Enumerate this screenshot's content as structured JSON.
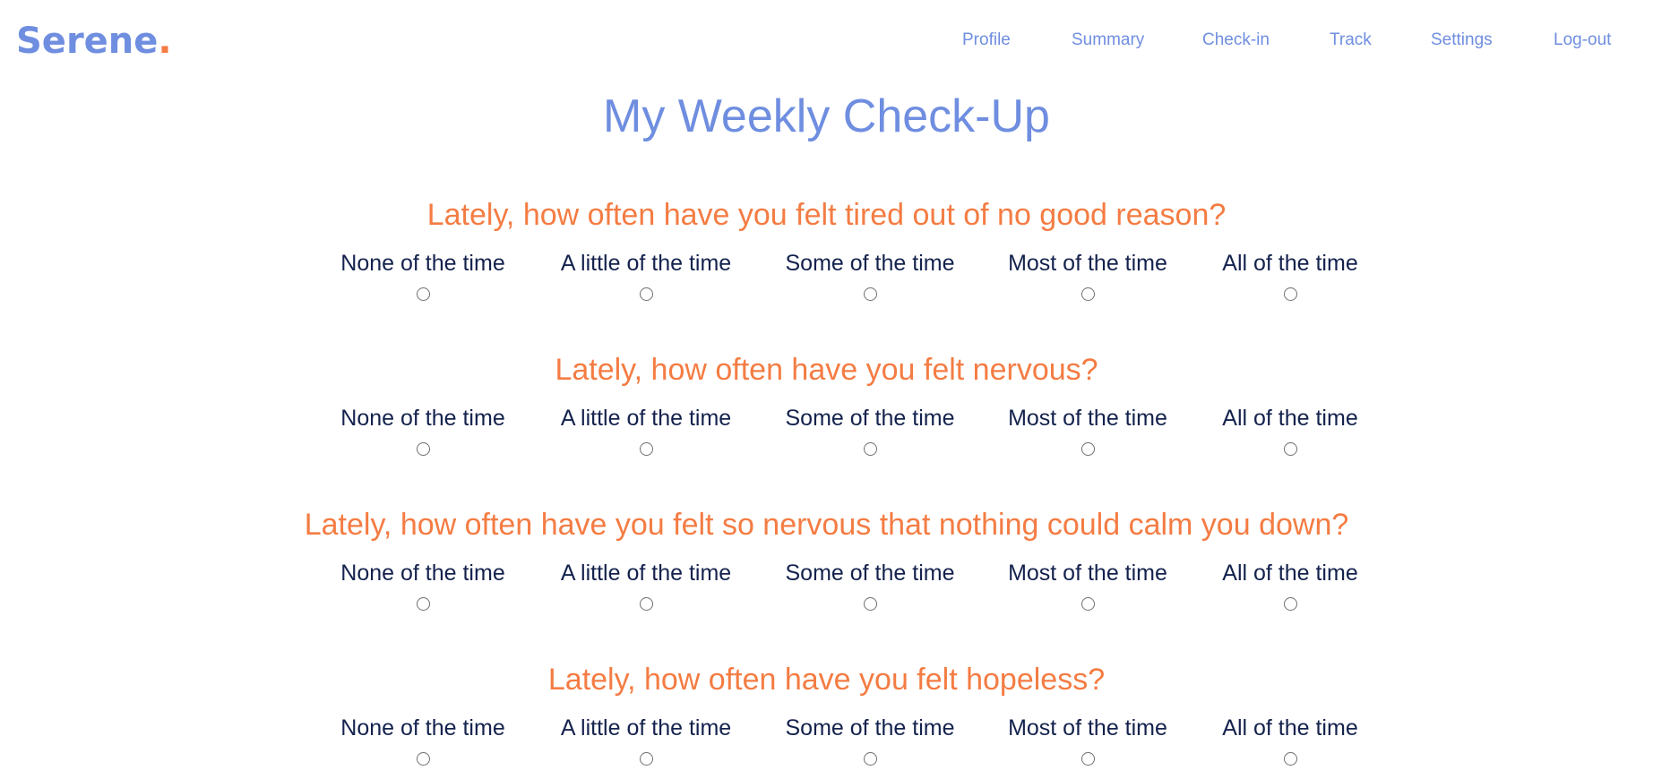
{
  "app": {
    "logo_text": "Serene",
    "logo_dot": ".",
    "colors": {
      "brand_blue": "#6f8ee0",
      "accent_orange": "#f47c43",
      "option_text": "#14224d",
      "radio_border": "#707070"
    }
  },
  "nav": {
    "items": [
      {
        "label": "Profile"
      },
      {
        "label": "Summary"
      },
      {
        "label": "Check-in"
      },
      {
        "label": "Track"
      },
      {
        "label": "Settings"
      },
      {
        "label": "Log-out"
      }
    ]
  },
  "page": {
    "title": "My Weekly Check-Up"
  },
  "questions": [
    {
      "text": "Lately, how often have you felt tired out of no good reason?",
      "options": [
        "None of the time",
        "A little of the time",
        "Some of the time",
        "Most of the time",
        "All of the time"
      ]
    },
    {
      "text": "Lately, how often have you felt nervous?",
      "options": [
        "None of the time",
        "A little of the time",
        "Some of the time",
        "Most of the time",
        "All of the time"
      ]
    },
    {
      "text": "Lately, how often have you felt so nervous that nothing could calm you down?",
      "options": [
        "None of the time",
        "A little of the time",
        "Some of the time",
        "Most of the time",
        "All of the time"
      ]
    },
    {
      "text": "Lately, how often have you felt hopeless?",
      "options": [
        "None of the time",
        "A little of the time",
        "Some of the time",
        "Most of the time",
        "All of the time"
      ]
    }
  ]
}
